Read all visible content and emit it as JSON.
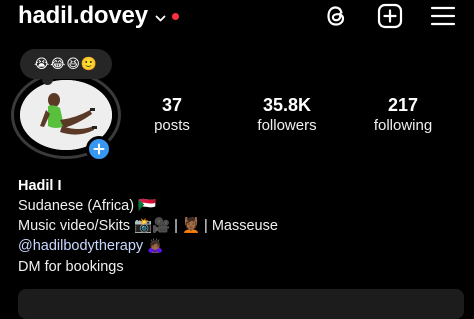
{
  "header": {
    "username": "hadil.dovey",
    "notification_dot_color": "#ff3040",
    "icons": [
      "threads-icon",
      "create-plus-icon",
      "menu-icon"
    ]
  },
  "note": {
    "text": "😭😂😆🙂"
  },
  "stats": [
    {
      "value": "37",
      "label": "posts"
    },
    {
      "value": "35.8K",
      "label": "followers"
    },
    {
      "value": "217",
      "label": "following"
    }
  ],
  "bio": {
    "name": "Hadil I",
    "line1": "Sudanese (Africa) 🇸🇩",
    "line2": "Music video/Skits 📸🎥 | 💆🏾 | Masseuse",
    "link": "@hadilbodytherapy",
    "link_emoji": "🙇🏾‍♀️",
    "line4": "DM for bookings"
  },
  "colors": {
    "background": "#000000",
    "link": "#c8d8ff",
    "add_story_button": "#3897f0",
    "note_bubble": "#262626"
  }
}
